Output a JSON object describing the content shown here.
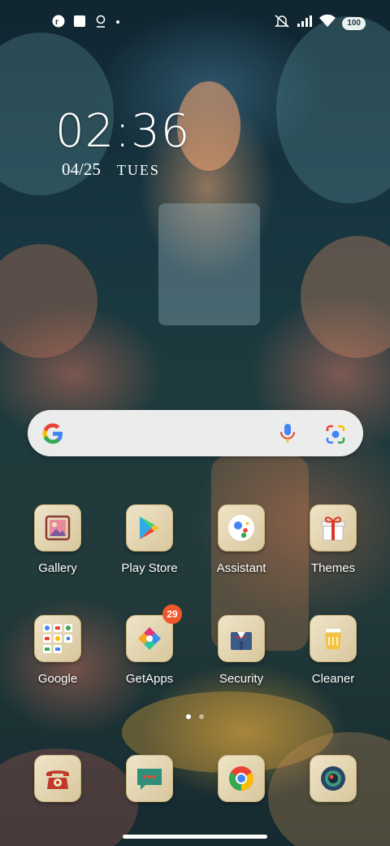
{
  "status_bar": {
    "battery_level": "100",
    "left_icons": [
      "app-notification-icon",
      "square-notification-icon",
      "location-pin-icon",
      "dot-icon"
    ],
    "right_icons": [
      "mute-icon",
      "signal-icon",
      "wifi-icon"
    ]
  },
  "clock": {
    "time": "02:36",
    "date": "04/25",
    "weekday": "TUES"
  },
  "search": {
    "icons": [
      "google-logo-icon",
      "microphone-icon",
      "google-lens-icon"
    ]
  },
  "apps": [
    {
      "label": "Gallery",
      "icon": "gallery-icon"
    },
    {
      "label": "Play Store",
      "icon": "play-store-icon"
    },
    {
      "label": "Assistant",
      "icon": "assistant-icon"
    },
    {
      "label": "Themes",
      "icon": "themes-gift-icon"
    },
    {
      "label": "Google",
      "icon": "google-folder-icon"
    },
    {
      "label": "GetApps",
      "icon": "getapps-icon",
      "badge": "29"
    },
    {
      "label": "Security",
      "icon": "security-icon"
    },
    {
      "label": "Cleaner",
      "icon": "cleaner-icon"
    }
  ],
  "dock": [
    {
      "icon": "phone-icon"
    },
    {
      "icon": "messages-icon"
    },
    {
      "icon": "chrome-icon"
    },
    {
      "icon": "camera-icon"
    }
  ],
  "pager": {
    "pages": 2,
    "active": 1
  },
  "colors": {
    "badge": "#f0572a",
    "icon_tile": "#e6d8b4"
  }
}
